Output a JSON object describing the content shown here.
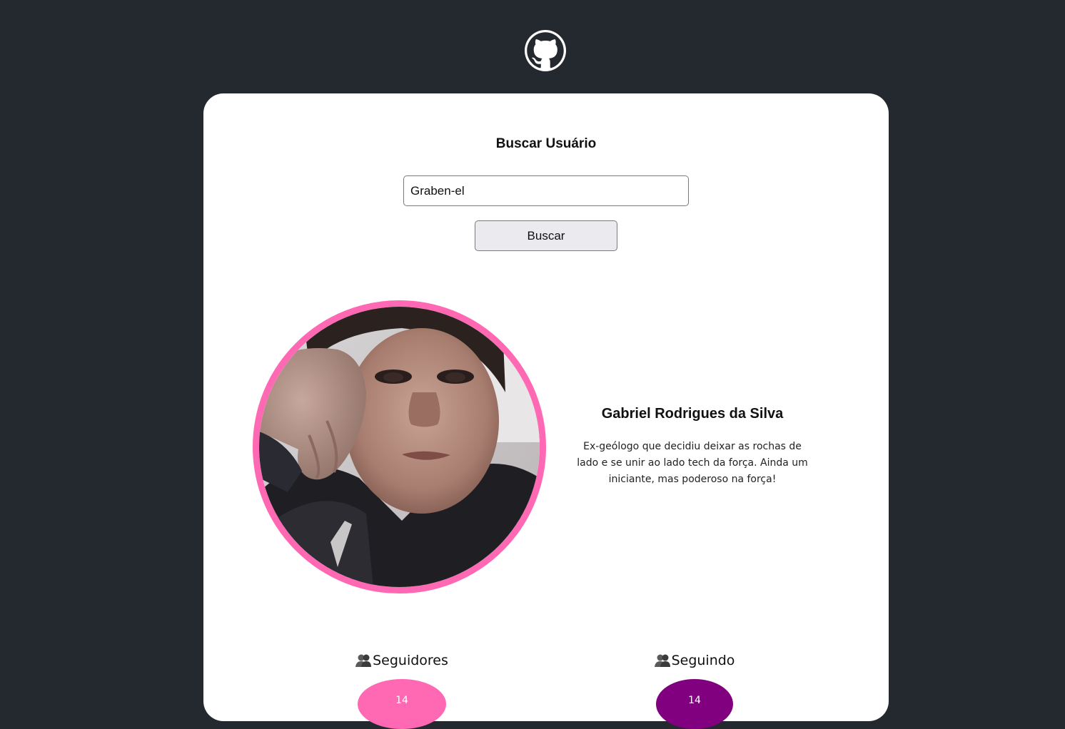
{
  "header": {
    "logo_icon": "github-octocat-icon"
  },
  "search": {
    "title": "Buscar Usuário",
    "input_value": "Graben-el",
    "button_label": "Buscar"
  },
  "profile": {
    "name": "Gabriel Rodrigues da Silva",
    "bio": "Ex-geólogo que decidiu deixar as rochas de lado e se unir ao lado tech da força. Ainda um iniciante, mas poderoso na força!"
  },
  "stats": {
    "followers": {
      "label": "Seguidores",
      "icon": "people-icon",
      "count": "14",
      "color": "#ff69b4"
    },
    "following": {
      "label": "Seguindo",
      "icon": "people-icon",
      "count": "14",
      "color": "#800080"
    }
  },
  "colors": {
    "background": "#24292f",
    "card": "#ffffff",
    "avatar_ring": "#ff69b4"
  }
}
